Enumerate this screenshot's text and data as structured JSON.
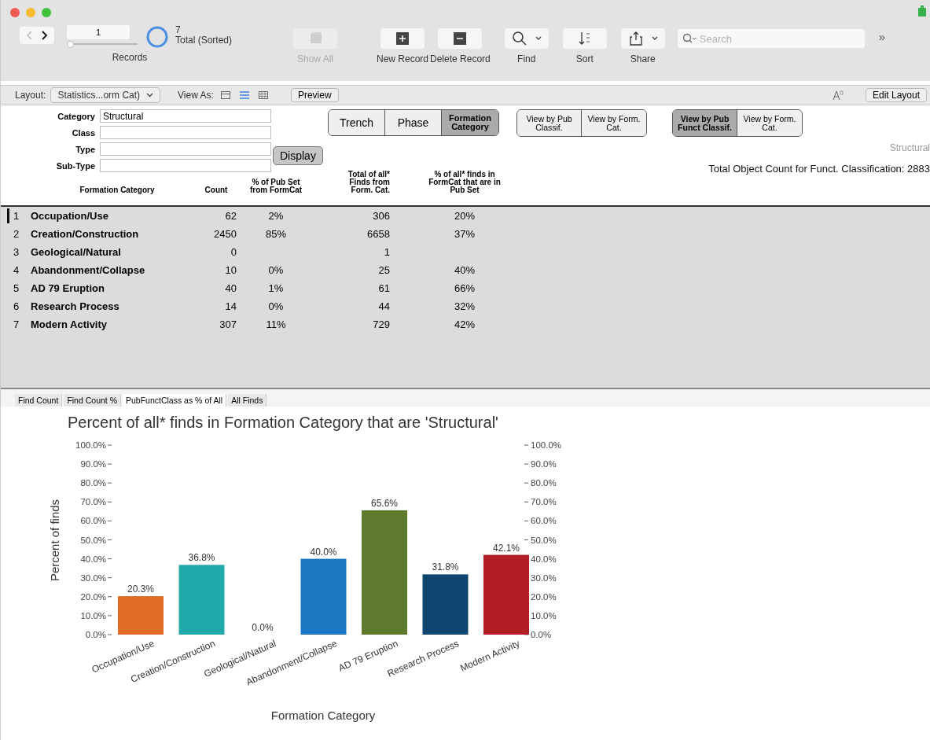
{
  "toolbar": {
    "record_number": "1",
    "record_slider": {
      "level": 0
    },
    "record_count": "7",
    "record_status": "Total (Sorted)",
    "records_label": "Records",
    "buttons": [
      {
        "kind": "showall",
        "label": "Show All",
        "disabled": true
      },
      {
        "kind": "new",
        "label": "New Record",
        "disabled": false
      },
      {
        "kind": "delete",
        "label": "Delete Record",
        "disabled": false
      },
      {
        "kind": "find",
        "label": "Find",
        "disabled": false
      },
      {
        "kind": "sort",
        "label": "Sort",
        "disabled": false
      },
      {
        "kind": "share",
        "label": "Share",
        "disabled": false
      }
    ],
    "search": {
      "placeholder": "Search"
    },
    "overflow": "»"
  },
  "layout_bar": {
    "layout_label": "Layout:",
    "layout_value": "Statistics...orm Cat)",
    "view_as_label": "View As:",
    "views": [
      {
        "kind": "form",
        "selected": false
      },
      {
        "kind": "list",
        "selected": true
      },
      {
        "kind": "table",
        "selected": false
      }
    ],
    "preview": "Preview",
    "edit_layout": "Edit Layout"
  },
  "filters": [
    {
      "label": "Category",
      "value": "Structural"
    },
    {
      "label": "Class"
    },
    {
      "label": "Type"
    },
    {
      "label": "Sub-Type"
    }
  ],
  "display_button": "Display",
  "segment_groups": [
    [
      {
        "label": "Trench",
        "selected": false
      },
      {
        "label": "Phase",
        "selected": false
      },
      {
        "label": "Formation Category",
        "selected": true
      }
    ],
    [
      {
        "label": "View by Pub Classif.",
        "selected": false
      },
      {
        "label": "View by Form. Cat.",
        "selected": false
      }
    ],
    [
      {
        "label": "View by Pub Funct Classif.",
        "selected": true
      },
      {
        "label": "View by Form. Cat.",
        "selected": false
      }
    ]
  ],
  "category_note": "Structural",
  "total_object_count": "Total Object Count for Funct. Classification: 2883",
  "table": {
    "columns": [
      "Formation Category",
      "Count",
      "% of Pub Set from FormCat",
      "Total of all* Finds from Form. Cat.",
      "% of all* finds in FormCat that are in Pub Set"
    ],
    "rows": [
      {
        "number": "1",
        "name": "Occupation/Use",
        "count": "62",
        "pub_pct": "2%",
        "total": "306",
        "all_pct": "20%",
        "selected": true
      },
      {
        "number": "2",
        "name": "Creation/Construction",
        "count": "2450",
        "pub_pct": "85%",
        "total": "6658",
        "all_pct": "37%",
        "selected": false
      },
      {
        "number": "3",
        "name": "Geological/Natural",
        "count": "0",
        "total": "1",
        "selected": false
      },
      {
        "number": "4",
        "name": "Abandonment/Collapse",
        "count": "10",
        "pub_pct": "0%",
        "total": "25",
        "all_pct": "40%",
        "selected": false
      },
      {
        "number": "5",
        "name": "AD 79 Eruption",
        "count": "40",
        "pub_pct": "1%",
        "total": "61",
        "all_pct": "66%",
        "selected": false
      },
      {
        "number": "6",
        "name": "Research Process",
        "count": "14",
        "pub_pct": "0%",
        "total": "44",
        "all_pct": "32%",
        "selected": false
      },
      {
        "number": "7",
        "name": "Modern Activity",
        "count": "307",
        "pub_pct": "11%",
        "total": "729",
        "all_pct": "42%",
        "selected": false
      }
    ]
  },
  "chart_tabs": [
    {
      "label": "Find Count",
      "selected": false
    },
    {
      "label": "Find Count %",
      "selected": false
    },
    {
      "label": "PubFunctClass as % of All",
      "selected": true
    },
    {
      "label": "All Finds",
      "selected": false
    }
  ],
  "chart_data": {
    "type": "bar",
    "title": "Percent of all* finds in Formation Category that are 'Structural'",
    "xlabel": "Formation Category",
    "ylabel": "Percent of finds",
    "categories": [
      "Occupation/Use",
      "Creation/Construction",
      "Geological/Natural",
      "Abandonment/Collapse",
      "AD 79 Eruption",
      "Research Process",
      "Modern Activity"
    ],
    "series": [
      {
        "color": "#e06c28",
        "values": [
          20.3,
          null,
          null,
          null,
          null,
          null,
          null
        ]
      },
      {
        "color": "#22a9a9",
        "values": [
          null,
          36.8,
          null,
          null,
          null,
          null,
          null
        ]
      },
      {
        "values": [
          null,
          null,
          0.0,
          null,
          null,
          null,
          null
        ]
      },
      {
        "color": "#1c77c3",
        "values": [
          null,
          null,
          null,
          40.0,
          null,
          null,
          null
        ]
      },
      {
        "color": "#5e7a2c",
        "values": [
          null,
          null,
          null,
          null,
          65.6,
          null,
          null
        ]
      },
      {
        "color": "#0e4670",
        "values": [
          null,
          null,
          null,
          null,
          null,
          31.8,
          null
        ]
      },
      {
        "color": "#b21e23",
        "values": [
          null,
          null,
          null,
          null,
          null,
          null,
          42.1
        ]
      }
    ],
    "value_labels": [
      "20.3%",
      "36.8%",
      "0.0%",
      "40.0%",
      "65.6%",
      "31.8%",
      "42.1%"
    ],
    "ylim": [
      0,
      100
    ],
    "y2lim": [
      0,
      100
    ],
    "yticks": [
      {
        "value": 0,
        "label": "0.0%"
      },
      {
        "value": 10,
        "label": "10.0%"
      },
      {
        "value": 20,
        "label": "20.0%"
      },
      {
        "value": 30,
        "label": "30.0%"
      },
      {
        "value": 40,
        "label": "40.0%"
      },
      {
        "value": 50,
        "label": "50.0%"
      },
      {
        "value": 60,
        "label": "60.0%"
      },
      {
        "value": 70,
        "label": "70.0%"
      },
      {
        "value": 80,
        "label": "80.0%"
      },
      {
        "value": 90,
        "label": "90.0%"
      },
      {
        "value": 100,
        "label": "100.0%"
      }
    ],
    "y2ticks": [
      {
        "value": 0,
        "label": "0.0%"
      },
      {
        "value": 10,
        "label": "10.0%"
      },
      {
        "value": 20,
        "label": "20.0%"
      },
      {
        "value": 30,
        "label": "30.0%"
      },
      {
        "value": 40,
        "label": "40.0%"
      },
      {
        "value": 50,
        "label": "50.0%"
      },
      {
        "value": 60,
        "label": "60.0%"
      },
      {
        "value": 70,
        "label": "70.0%"
      },
      {
        "value": 80,
        "label": "80.0%"
      },
      {
        "value": 90,
        "label": "90.0%"
      },
      {
        "value": 100,
        "label": "100.0%"
      }
    ]
  }
}
